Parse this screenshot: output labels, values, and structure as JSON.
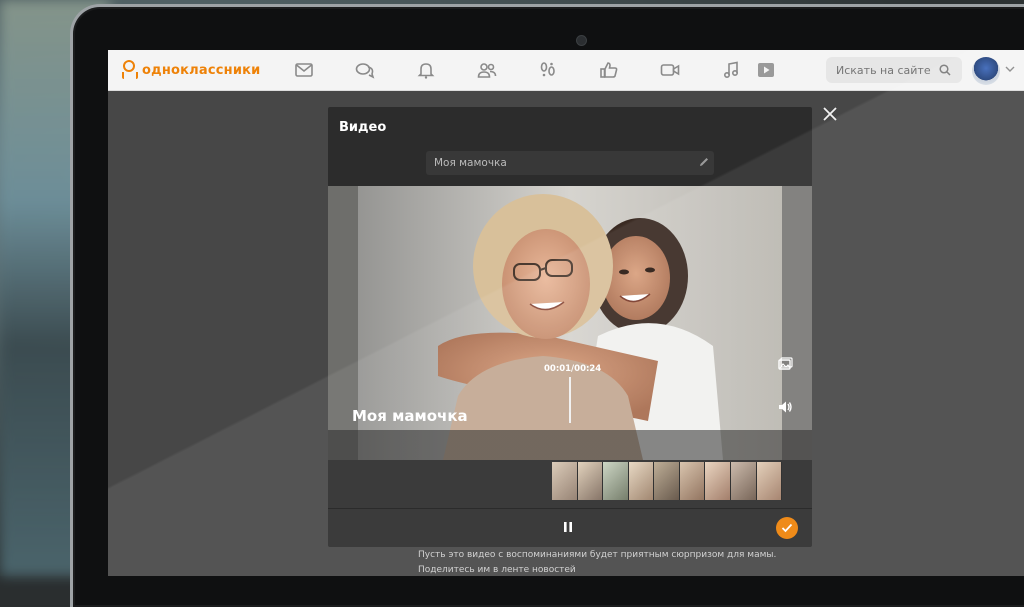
{
  "brand": {
    "name": "одноклассники",
    "color": "#ee8208"
  },
  "nav": {
    "icons": [
      "mail-icon",
      "chat-icon",
      "bell-icon",
      "friends-icon",
      "guests-icon",
      "likes-icon",
      "video-icon",
      "music-icon",
      "video-feed-icon"
    ],
    "search_placeholder": "Искать на сайте"
  },
  "modal": {
    "title": "Видео",
    "video_title_value": "Моя мамочка",
    "caption": "Моя мамочка",
    "timecode": "00:01/00:24",
    "description": "Пусть это видео с воспоминаниями будет приятным сюрпризом для мамы. Поделитесь им в ленте новостей"
  },
  "colors": {
    "accent": "#ee8208",
    "modal_bg": "#2c2c2c",
    "nav_bg": "#f4f4f4"
  }
}
